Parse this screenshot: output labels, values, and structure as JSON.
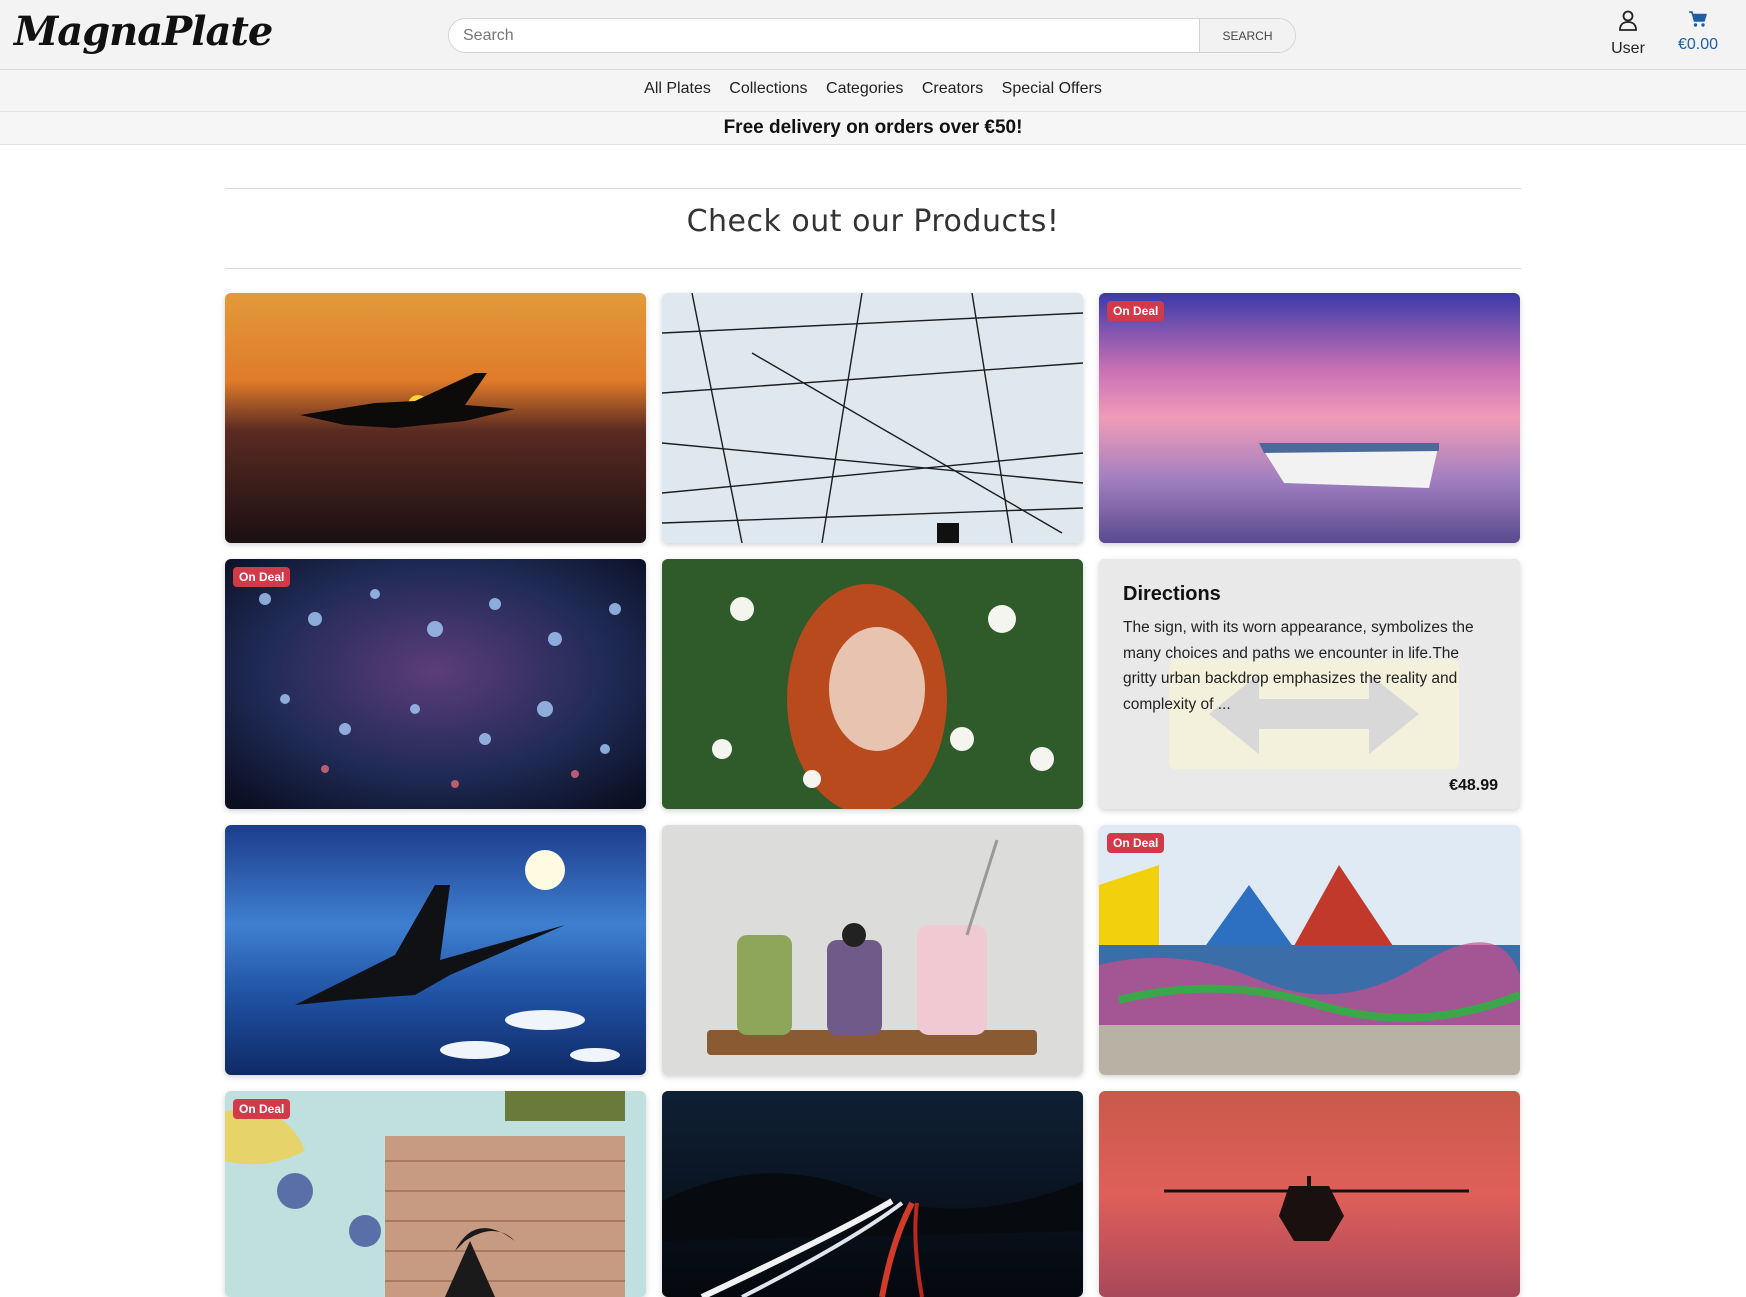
{
  "header": {
    "logo": "MagnaPlate",
    "search_placeholder": "Search",
    "search_button": "SEARCH",
    "user_label": "User",
    "cart_total": "€0.00"
  },
  "nav": {
    "items": [
      "All Plates",
      "Collections",
      "Categories",
      "Creators",
      "Special Offers"
    ]
  },
  "promo": "Free delivery on orders over €50!",
  "section_title": "Check out our Products!",
  "colors": {
    "accent_blue": "#1e5fa8",
    "deal_badge": "#d23a4a"
  },
  "badge_label": "On Deal",
  "products": [
    {
      "scene": "fighter-jet-sunset",
      "on_deal": false
    },
    {
      "scene": "power-lines",
      "on_deal": false
    },
    {
      "scene": "boat-pink-sky",
      "on_deal": true
    },
    {
      "scene": "floating-lanterns",
      "on_deal": true
    },
    {
      "scene": "redhead-flowers",
      "on_deal": false
    },
    {
      "scene": "directions-sign",
      "on_deal": false,
      "hovered": true,
      "title": "Directions",
      "description": "The sign, with its worn appearance, symbolizes the many choices and paths we encounter in life.The gritty urban backdrop emphasizes the reality and complexity of ...",
      "price": "€48.99"
    },
    {
      "scene": "jet-above-clouds",
      "on_deal": false
    },
    {
      "scene": "smoothie-jars",
      "on_deal": false
    },
    {
      "scene": "graffiti-houses",
      "on_deal": true
    },
    {
      "scene": "graffiti-garage",
      "on_deal": true
    },
    {
      "scene": "highway-light-trails",
      "on_deal": false
    },
    {
      "scene": "helicopter-red-sky",
      "on_deal": false
    }
  ]
}
